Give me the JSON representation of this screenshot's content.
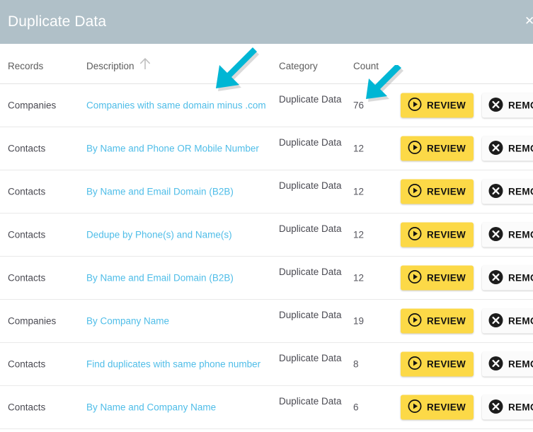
{
  "window": {
    "title": "Duplicate Data",
    "close_label": "✕",
    "header_color": "#b0c0c8"
  },
  "colors": {
    "accent_cyan": "#00b6d4",
    "link_blue": "#4fbde8",
    "review_yellow": "#fcd947",
    "remove_dark": "#1d1d1d"
  },
  "table": {
    "columns": [
      {
        "key": "records",
        "label": "Records"
      },
      {
        "key": "description",
        "label": "Description",
        "sort_icon": "sort-ascending-arrow-icon"
      },
      {
        "key": "category",
        "label": "Category"
      },
      {
        "key": "count",
        "label": "Count"
      }
    ],
    "actions": {
      "review_label": "REVIEW",
      "review_icon": "play-circle-icon",
      "remove_label": "REMOVE",
      "remove_icon": "x-circle-icon"
    },
    "rows": [
      {
        "records": "Companies",
        "description": "Companies with same domain minus .com",
        "category": "Duplicate Data",
        "count": "76"
      },
      {
        "records": "Contacts",
        "description": "By Name and Phone OR Mobile Number",
        "category": "Duplicate Data",
        "count": "12"
      },
      {
        "records": "Contacts",
        "description": "By Name and Email Domain (B2B)",
        "category": "Duplicate Data",
        "count": "12"
      },
      {
        "records": "Contacts",
        "description": "Dedupe by Phone(s) and Name(s)",
        "category": "Duplicate Data",
        "count": "12"
      },
      {
        "records": "Contacts",
        "description": "By Name and Email Domain (B2B)",
        "category": "Duplicate Data",
        "count": "12"
      },
      {
        "records": "Companies",
        "description": "By Company Name",
        "category": "Duplicate Data",
        "count": "19"
      },
      {
        "records": "Contacts",
        "description": "Find duplicates with same phone number",
        "category": "Duplicate Data",
        "count": "8"
      },
      {
        "records": "Contacts",
        "description": "By Name and Company Name",
        "category": "Duplicate Data",
        "count": "6"
      }
    ]
  },
  "annotations": [
    {
      "name": "arrow-to-description-link",
      "direction": "down-left",
      "color": "#00b6d4"
    },
    {
      "name": "arrow-to-count-value",
      "direction": "down-left",
      "color": "#00b6d4"
    }
  ]
}
